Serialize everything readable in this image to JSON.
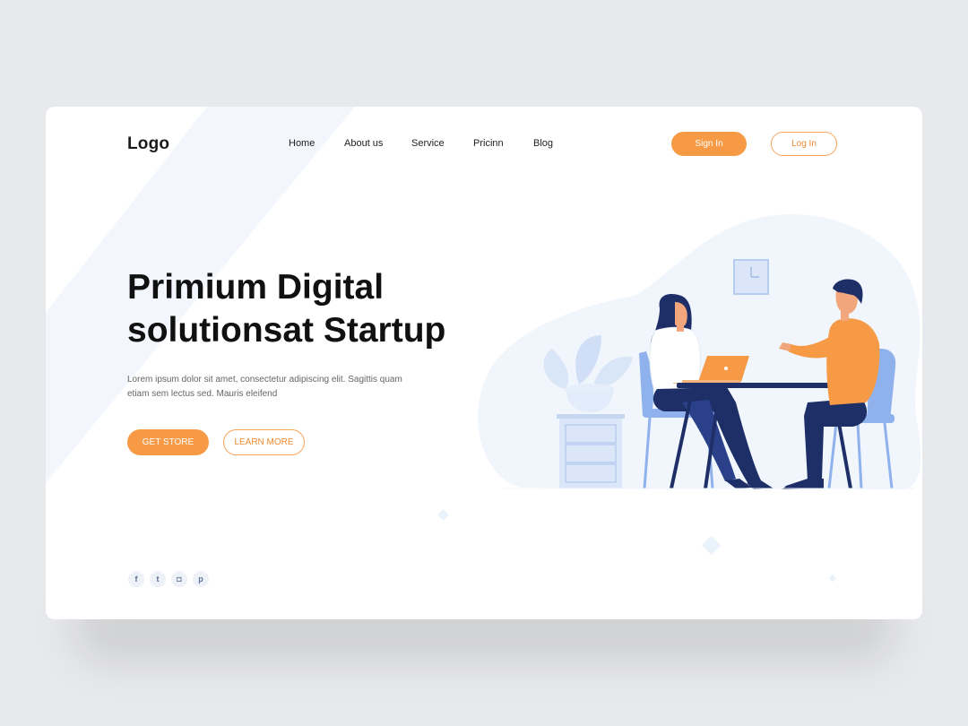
{
  "header": {
    "logo": "Logo",
    "nav": [
      "Home",
      "About us",
      "Service",
      "Pricinn",
      "Blog"
    ],
    "sign_in": "Sign In",
    "log_in": "Log In"
  },
  "hero": {
    "title_line1": "Primium Digital",
    "title_line2": "solutionsat Startup",
    "description": "Lorem ipsum dolor sit amet, consectetur adipiscing elit. Sagittis quam etiam sem lectus sed. Mauris eleifend",
    "primary_button": "GET STORE",
    "secondary_button": "LEARN MORE"
  },
  "social": [
    {
      "icon": "facebook-icon",
      "glyph": "f"
    },
    {
      "icon": "twitter-icon",
      "glyph": "t"
    },
    {
      "icon": "instagram-icon",
      "glyph": "◘"
    },
    {
      "icon": "pinterest-icon",
      "glyph": "p"
    }
  ],
  "colors": {
    "accent": "#f79a45",
    "accent_text": "#f08a31",
    "background": "#e8e9ec",
    "card": "#ffffff",
    "illustration_blue": "#8fb1ec",
    "illustration_navy": "#1d2f66"
  }
}
